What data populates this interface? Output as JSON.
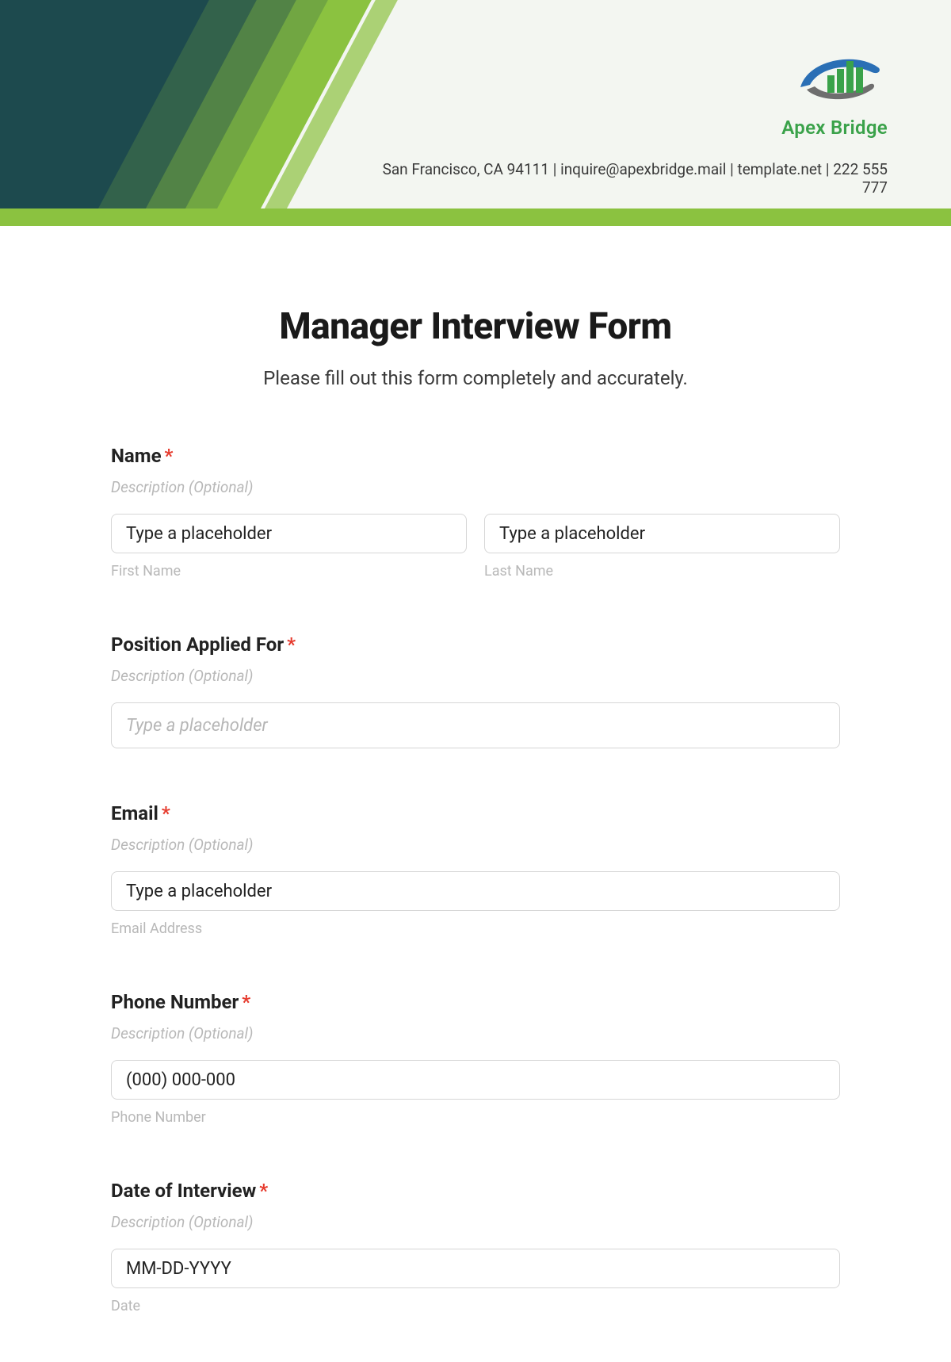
{
  "brand": {
    "name": "Apex Bridge",
    "contact": "San Francisco, CA 94111 | inquire@apexbridge.mail | template.net | 222 555 777"
  },
  "form": {
    "title": "Manager Interview Form",
    "subtitle": "Please fill out this form completely and accurately.",
    "required_mark": "*",
    "desc_placeholder": "Description (Optional)",
    "fields": {
      "name": {
        "label": "Name",
        "first_placeholder": "Type a placeholder",
        "last_placeholder": "Type a placeholder",
        "first_sub": "First Name",
        "last_sub": "Last Name"
      },
      "position": {
        "label": "Position Applied For",
        "placeholder": "Type a placeholder"
      },
      "email": {
        "label": "Email",
        "placeholder": "Type a placeholder",
        "sub": "Email Address"
      },
      "phone": {
        "label": "Phone Number",
        "placeholder": "(000) 000-000",
        "sub": "Phone Number"
      },
      "date": {
        "label": "Date of Interview",
        "placeholder": "MM-DD-YYYY",
        "sub": "Date"
      }
    }
  }
}
